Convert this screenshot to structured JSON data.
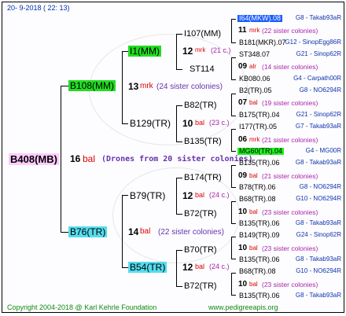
{
  "header": "20- 9-2018 ( 22: 13)",
  "footer_left": "Copyright 2004-2018 @ Karl Kehrle Foundation",
  "footer_right": "www.pedigreeapis.org",
  "root": {
    "id": "B408(MB)",
    "gen_num": "16",
    "gen_abbr": "bal",
    "note": "(Drones from 20 sister colonies)"
  },
  "gen1": [
    {
      "id": "B108(MM)",
      "gen_num": "13",
      "gen_abbr": "mrk",
      "note": "(24 sister colonies)"
    },
    {
      "id": "B76(TR)",
      "gen_num": "14",
      "gen_abbr": "bal",
      "note": "(22 sister colonies)"
    }
  ],
  "gen2": [
    {
      "id": "I1(MM)",
      "gen_num": "",
      "gen_abbr": "",
      "note": ""
    },
    {
      "id": "B129(TR)",
      "gen_num": "10",
      "gen_abbr": "bal",
      "note": "(23 c.)"
    },
    {
      "id": "B79(TR)",
      "gen_num": "12",
      "gen_abbr": "bal",
      "note": "(24 c.)"
    },
    {
      "id": "B54(TR)",
      "gen_num": "12",
      "gen_abbr": "bal",
      "note": "(24 c.)"
    }
  ],
  "gen3": [
    {
      "id": "I107(MM)",
      "gen_num": "12",
      "gen_abbr": "mrk",
      "note": "(21 c.)"
    },
    {
      "id": "ST114",
      "gen_num": "",
      "gen_abbr": "",
      "note": ""
    },
    {
      "id": "B82(TR)",
      "gen_num": "10",
      "gen_abbr": "bal",
      "note": "(23 c.)"
    },
    {
      "id": "B135(TR)",
      "gen_num": "",
      "gen_abbr": "",
      "note": ""
    },
    {
      "id": "B174(TR)",
      "gen_num": "12",
      "gen_abbr": "bal",
      "note": "(24 c.)"
    },
    {
      "id": "B72(TR)",
      "gen_num": "",
      "gen_abbr": "",
      "note": ""
    },
    {
      "id": "B70(TR)",
      "gen_num": "12",
      "gen_abbr": "bal",
      "note": "(24 c.)"
    },
    {
      "id": "B72(TR)",
      "gen_num": "",
      "gen_abbr": "",
      "note": ""
    }
  ],
  "gen4": [
    {
      "id": "I64(MKW).08",
      "source": "G8 - Takab93aR"
    },
    {
      "id": "11",
      "abbr": "mrk",
      "note": "(22 sister colonies)",
      "type": "gen"
    },
    {
      "id": "B181(MKR).07",
      "source": "G12 - SinopEgg86R"
    },
    {
      "id": "ST348.07",
      "source": "G21 - Sinop62R"
    },
    {
      "id": "09",
      "abbr": "alr",
      "note": "(14 sister colonies)",
      "type": "gen"
    },
    {
      "id": "KB080.06",
      "source": "G4 - Carpath00R"
    },
    {
      "id": "B2(TR).05",
      "source": "G8 - NO6294R"
    },
    {
      "id": "07",
      "abbr": "bal",
      "note": "(19 sister colonies)",
      "type": "gen"
    },
    {
      "id": "B175(TR).04",
      "source": "G21 - Sinop62R"
    },
    {
      "id": "I177(TR).05",
      "source": "G7 - Takab93aR"
    },
    {
      "id": "06",
      "abbr": "mrk",
      "note": "(21 sister colonies)",
      "type": "gen"
    },
    {
      "id": "MG60(TR).04",
      "source": "G4 - MG00R"
    },
    {
      "id": "B135(TR).06",
      "source": "G8 - Takab93aR"
    },
    {
      "id": "09",
      "abbr": "bal",
      "note": "(21 sister colonies)",
      "type": "gen"
    },
    {
      "id": "B78(TR).06",
      "source": "G8 - NO6294R"
    },
    {
      "id": "B68(TR).08",
      "source": "G10 - NO6294R"
    },
    {
      "id": "10",
      "abbr": "bal",
      "note": "(23 sister colonies)",
      "type": "gen"
    },
    {
      "id": "B135(TR).06",
      "source": "G8 - Takab93aR"
    },
    {
      "id": "B149(TR).09",
      "source": "G24 - Sinop62R"
    },
    {
      "id": "10",
      "abbr": "bal",
      "note": "(23 sister colonies)",
      "type": "gen"
    },
    {
      "id": "B135(TR).06",
      "source": "G8 - Takab93aR"
    },
    {
      "id": "B68(TR).08",
      "source": "G10 - NO6294R"
    },
    {
      "id": "10",
      "abbr": "bal",
      "note": "(23 sister colonies)",
      "type": "gen"
    },
    {
      "id": "B135(TR).06",
      "source": "G8 - Takab93aR"
    }
  ],
  "colors": {
    "root_bg": "#ffccff",
    "green": "#22dd22",
    "cyan": "#55ddee",
    "blue": "#1a5cff"
  }
}
